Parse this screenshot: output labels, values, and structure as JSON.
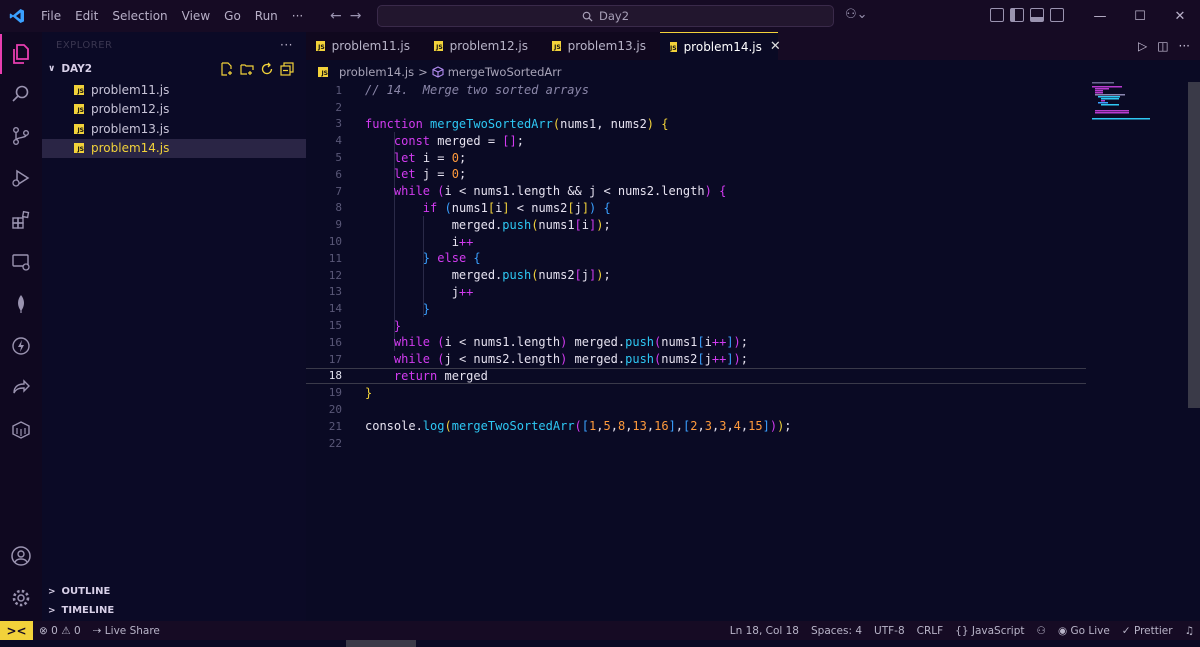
{
  "titlebar": {
    "menu": [
      "File",
      "Edit",
      "Selection",
      "View",
      "Go",
      "Run",
      "···"
    ],
    "search": "Day2"
  },
  "sidebar": {
    "header": "EXPLORER",
    "more": "···",
    "folder": "DAY2",
    "files": [
      {
        "name": "problem11.js",
        "active": false
      },
      {
        "name": "problem12.js",
        "active": false
      },
      {
        "name": "problem13.js",
        "active": false
      },
      {
        "name": "problem14.js",
        "active": true
      }
    ],
    "outline": "OUTLINE",
    "timeline": "TIMELINE"
  },
  "tabs": [
    {
      "name": "problem11.js",
      "active": false
    },
    {
      "name": "problem12.js",
      "active": false
    },
    {
      "name": "problem13.js",
      "active": false
    },
    {
      "name": "problem14.js",
      "active": true
    }
  ],
  "breadcrumb": {
    "file": "problem14.js",
    "separator": ">",
    "symbol": "mergeTwoSortedArr"
  },
  "editor": {
    "current_line": 18,
    "lines": [
      {
        "n": "1",
        "tokens": [
          [
            "cm",
            "// 14.  Merge two sorted arrays"
          ]
        ]
      },
      {
        "n": "2",
        "tokens": []
      },
      {
        "n": "3",
        "tokens": [
          [
            "kw",
            "function "
          ],
          [
            "fn",
            "mergeTwoSortedArr"
          ],
          [
            "p1",
            "("
          ],
          [
            "id",
            "nums1, nums2"
          ],
          [
            "p1",
            ")"
          ],
          [
            "id",
            " "
          ],
          [
            "p1",
            "{"
          ]
        ]
      },
      {
        "n": "4",
        "tokens": [
          [
            "id",
            "    "
          ],
          [
            "kw",
            "const "
          ],
          [
            "id",
            "merged = "
          ],
          [
            "p2",
            "[]"
          ],
          [
            "id",
            ";"
          ]
        ]
      },
      {
        "n": "5",
        "tokens": [
          [
            "id",
            "    "
          ],
          [
            "kw",
            "let "
          ],
          [
            "id",
            "i = "
          ],
          [
            "num",
            "0"
          ],
          [
            "id",
            ";"
          ]
        ]
      },
      {
        "n": "6",
        "tokens": [
          [
            "id",
            "    "
          ],
          [
            "kw",
            "let "
          ],
          [
            "id",
            "j = "
          ],
          [
            "num",
            "0"
          ],
          [
            "id",
            ";"
          ]
        ]
      },
      {
        "n": "7",
        "tokens": [
          [
            "id",
            "    "
          ],
          [
            "kw",
            "while "
          ],
          [
            "p2",
            "("
          ],
          [
            "id",
            "i < nums1.length && j < nums2.length"
          ],
          [
            "p2",
            ")"
          ],
          [
            "id",
            " "
          ],
          [
            "p2",
            "{"
          ]
        ]
      },
      {
        "n": "8",
        "tokens": [
          [
            "id",
            "        "
          ],
          [
            "kw",
            "if "
          ],
          [
            "p3",
            "("
          ],
          [
            "id",
            "nums1"
          ],
          [
            "p1",
            "["
          ],
          [
            "id",
            "i"
          ],
          [
            "p1",
            "]"
          ],
          [
            "id",
            " < nums2"
          ],
          [
            "p1",
            "["
          ],
          [
            "id",
            "j"
          ],
          [
            "p1",
            "]"
          ],
          [
            "p3",
            ")"
          ],
          [
            "id",
            " "
          ],
          [
            "p3",
            "{"
          ]
        ]
      },
      {
        "n": "9",
        "tokens": [
          [
            "id",
            "            merged."
          ],
          [
            "fn",
            "push"
          ],
          [
            "p1",
            "("
          ],
          [
            "id",
            "nums1"
          ],
          [
            "p2",
            "["
          ],
          [
            "id",
            "i"
          ],
          [
            "p2",
            "]"
          ],
          [
            "p1",
            ")"
          ],
          [
            "id",
            ";"
          ]
        ]
      },
      {
        "n": "10",
        "tokens": [
          [
            "id",
            "            i"
          ],
          [
            "kw",
            "++"
          ]
        ]
      },
      {
        "n": "11",
        "tokens": [
          [
            "id",
            "        "
          ],
          [
            "p3",
            "}"
          ],
          [
            "id",
            " "
          ],
          [
            "kw",
            "else "
          ],
          [
            "p3",
            "{"
          ]
        ]
      },
      {
        "n": "12",
        "tokens": [
          [
            "id",
            "            merged."
          ],
          [
            "fn",
            "push"
          ],
          [
            "p1",
            "("
          ],
          [
            "id",
            "nums2"
          ],
          [
            "p2",
            "["
          ],
          [
            "id",
            "j"
          ],
          [
            "p2",
            "]"
          ],
          [
            "p1",
            ")"
          ],
          [
            "id",
            ";"
          ]
        ]
      },
      {
        "n": "13",
        "tokens": [
          [
            "id",
            "            j"
          ],
          [
            "kw",
            "++"
          ]
        ]
      },
      {
        "n": "14",
        "tokens": [
          [
            "id",
            "        "
          ],
          [
            "p3",
            "}"
          ]
        ]
      },
      {
        "n": "15",
        "tokens": [
          [
            "id",
            "    "
          ],
          [
            "p2",
            "}"
          ]
        ]
      },
      {
        "n": "16",
        "tokens": [
          [
            "id",
            "    "
          ],
          [
            "kw",
            "while "
          ],
          [
            "p2",
            "("
          ],
          [
            "id",
            "i < nums1.length"
          ],
          [
            "p2",
            ")"
          ],
          [
            "id",
            " merged."
          ],
          [
            "fn",
            "push"
          ],
          [
            "p2",
            "("
          ],
          [
            "id",
            "nums1"
          ],
          [
            "p3",
            "["
          ],
          [
            "id",
            "i"
          ],
          [
            "kw",
            "++"
          ],
          [
            "p3",
            "]"
          ],
          [
            "p2",
            ")"
          ],
          [
            "id",
            ";"
          ]
        ]
      },
      {
        "n": "17",
        "tokens": [
          [
            "id",
            "    "
          ],
          [
            "kw",
            "while "
          ],
          [
            "p2",
            "("
          ],
          [
            "id",
            "j < nums2.length"
          ],
          [
            "p2",
            ")"
          ],
          [
            "id",
            " merged."
          ],
          [
            "fn",
            "push"
          ],
          [
            "p2",
            "("
          ],
          [
            "id",
            "nums2"
          ],
          [
            "p3",
            "["
          ],
          [
            "id",
            "j"
          ],
          [
            "kw",
            "++"
          ],
          [
            "p3",
            "]"
          ],
          [
            "p2",
            ")"
          ],
          [
            "id",
            ";"
          ]
        ]
      },
      {
        "n": "18",
        "tokens": [
          [
            "id",
            "    "
          ],
          [
            "kw",
            "return "
          ],
          [
            "id",
            "merged"
          ]
        ]
      },
      {
        "n": "19",
        "tokens": [
          [
            "p1",
            "}"
          ]
        ]
      },
      {
        "n": "20",
        "tokens": []
      },
      {
        "n": "21",
        "tokens": [
          [
            "id",
            "console."
          ],
          [
            "fn",
            "log"
          ],
          [
            "p1",
            "("
          ],
          [
            "fn",
            "mergeTwoSortedArr"
          ],
          [
            "p2",
            "("
          ],
          [
            "p3",
            "["
          ],
          [
            "num",
            "1"
          ],
          [
            "id",
            ","
          ],
          [
            "num",
            "5"
          ],
          [
            "id",
            ","
          ],
          [
            "num",
            "8"
          ],
          [
            "id",
            ","
          ],
          [
            "num",
            "13"
          ],
          [
            "id",
            ","
          ],
          [
            "num",
            "16"
          ],
          [
            "p3",
            "]"
          ],
          [
            "id",
            ","
          ],
          [
            "p3",
            "["
          ],
          [
            "num",
            "2"
          ],
          [
            "id",
            ","
          ],
          [
            "num",
            "3"
          ],
          [
            "id",
            ","
          ],
          [
            "num",
            "3"
          ],
          [
            "id",
            ","
          ],
          [
            "num",
            "4"
          ],
          [
            "id",
            ","
          ],
          [
            "num",
            "15"
          ],
          [
            "p3",
            "]"
          ],
          [
            "p2",
            ")"
          ],
          [
            "p1",
            ")"
          ],
          [
            "id",
            ";"
          ]
        ]
      },
      {
        "n": "22",
        "tokens": []
      }
    ]
  },
  "statusbar": {
    "remote": "><",
    "problems": "0",
    "warnings": "0",
    "live_share": "Live Share",
    "position": "Ln 18, Col 18",
    "spaces": "Spaces: 4",
    "encoding": "UTF-8",
    "eol": "CRLF",
    "language_braces": "{}",
    "language": "JavaScript",
    "go_live": "Go Live",
    "prettier": "Prettier"
  },
  "colors": {
    "accent": "#f2d23a",
    "activity_active": "#e83eb0",
    "keyword": "#d23bf0",
    "function": "#2ec8f4",
    "number": "#ff9a3c"
  }
}
